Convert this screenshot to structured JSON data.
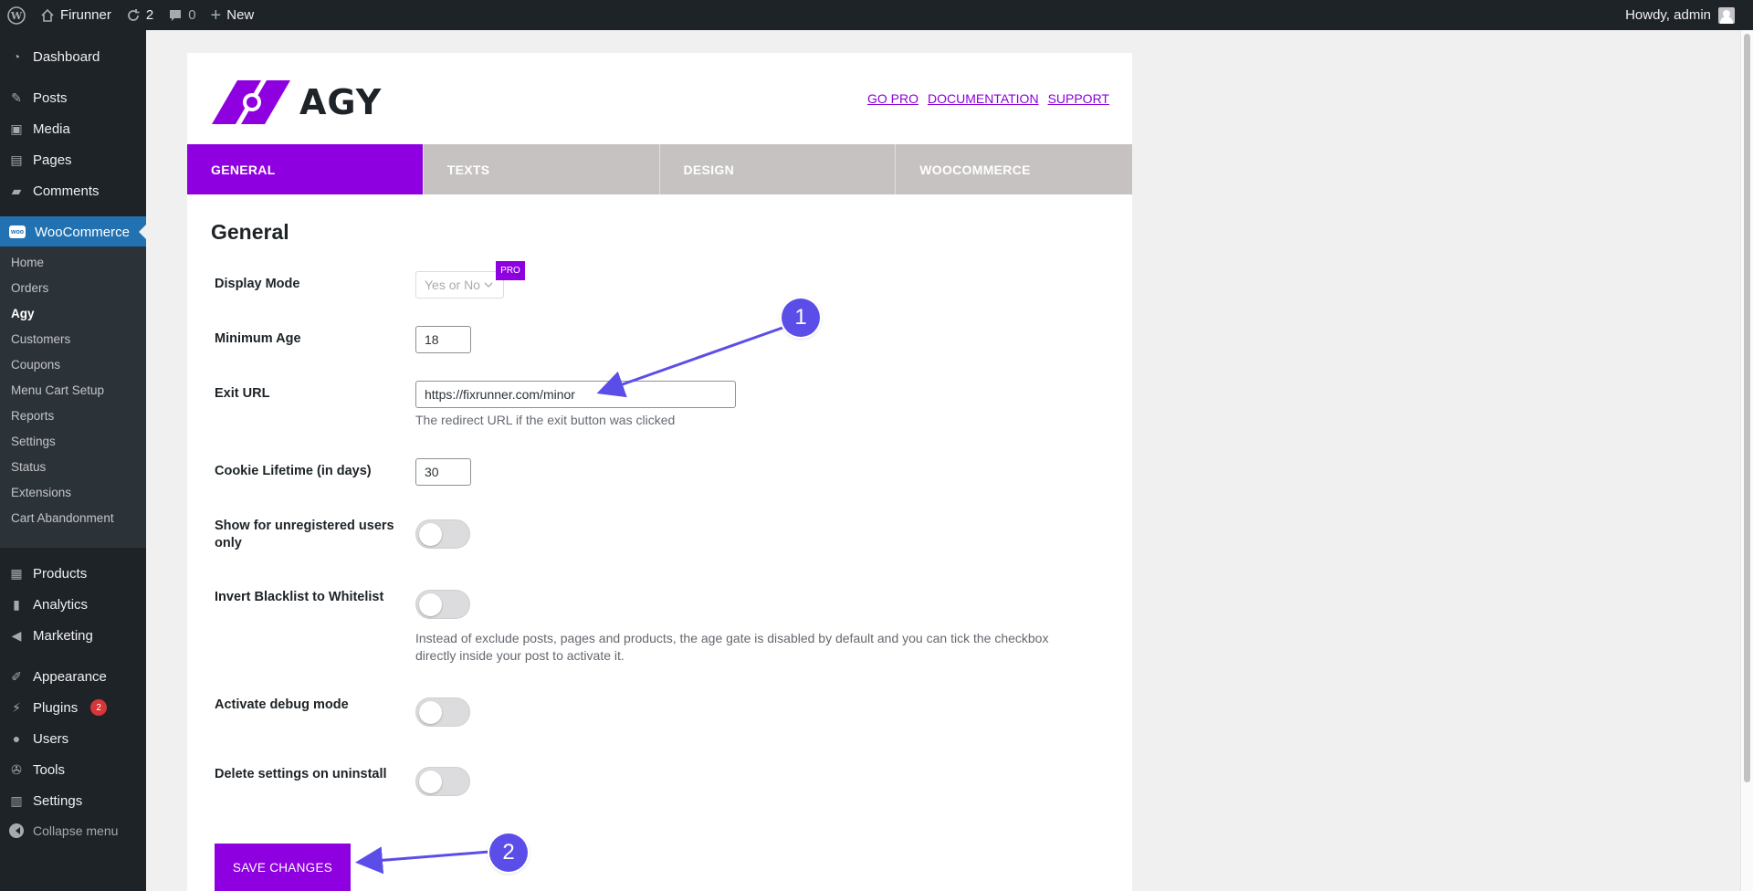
{
  "adminbar": {
    "site_name": "Firunner",
    "updates_count": "2",
    "comments_count": "0",
    "new_label": "New",
    "howdy": "Howdy, admin"
  },
  "sidebar": {
    "top_items": [
      {
        "label": "Dashboard",
        "icon": "dashboard-icon"
      },
      {
        "label": "Posts",
        "icon": "pin-icon"
      },
      {
        "label": "Media",
        "icon": "media-icon"
      },
      {
        "label": "Pages",
        "icon": "pages-icon"
      },
      {
        "label": "Comments",
        "icon": "comment-icon"
      }
    ],
    "woocommerce": {
      "label": "WooCommerce",
      "icon": "woo-icon"
    },
    "submenu": [
      "Home",
      "Orders",
      "Agy",
      "Customers",
      "Coupons",
      "Menu Cart Setup",
      "Reports",
      "Settings",
      "Status",
      "Extensions",
      "Cart Abandonment"
    ],
    "current_sub": "Agy",
    "bottom_items": [
      {
        "label": "Products",
        "icon": "archive-icon"
      },
      {
        "label": "Analytics",
        "icon": "chart-icon"
      },
      {
        "label": "Marketing",
        "icon": "megaphone-icon"
      },
      {
        "label": "Appearance",
        "icon": "brush-icon"
      },
      {
        "label": "Plugins",
        "icon": "plugin-icon",
        "badge": "2"
      },
      {
        "label": "Users",
        "icon": "user-icon"
      },
      {
        "label": "Tools",
        "icon": "wrench-icon"
      },
      {
        "label": "Settings",
        "icon": "settings-icon"
      }
    ],
    "collapse_label": "Collapse menu"
  },
  "header": {
    "logo_text": "AGY",
    "links": [
      "GO PRO",
      "DOCUMENTATION",
      "SUPPORT"
    ],
    "accent": "#8e00e0"
  },
  "tabs": [
    "GENERAL",
    "TEXTS",
    "DESIGN",
    "WOOCOMMERCE"
  ],
  "active_tab": "GENERAL",
  "section_title": "General",
  "fields": {
    "display_mode": {
      "label": "Display Mode",
      "value": "Yes or No",
      "badge": "PRO"
    },
    "minimum_age": {
      "label": "Minimum Age",
      "value": "18"
    },
    "exit_url": {
      "label": "Exit URL",
      "value": "https://fixrunner.com/minor",
      "description": "The redirect URL if the exit button was clicked"
    },
    "cookie_lifetime": {
      "label": "Cookie Lifetime (in days)",
      "value": "30"
    },
    "unregistered": {
      "label_line1": "Show for unregistered users",
      "label_line2": "only",
      "checked": false
    },
    "invert_blacklist": {
      "label": "Invert Blacklist to Whitelist",
      "checked": false,
      "description_line1": "Instead of exclude posts, pages and products, the age gate is disabled by default and you can tick the checkbox",
      "description_line2": "directly inside your post to activate it."
    },
    "debug_mode": {
      "label": "Activate debug mode",
      "checked": false
    },
    "delete_settings": {
      "label": "Delete settings on uninstall",
      "checked": false
    }
  },
  "save_button": "SAVE CHANGES",
  "annotations": [
    "1",
    "2"
  ]
}
